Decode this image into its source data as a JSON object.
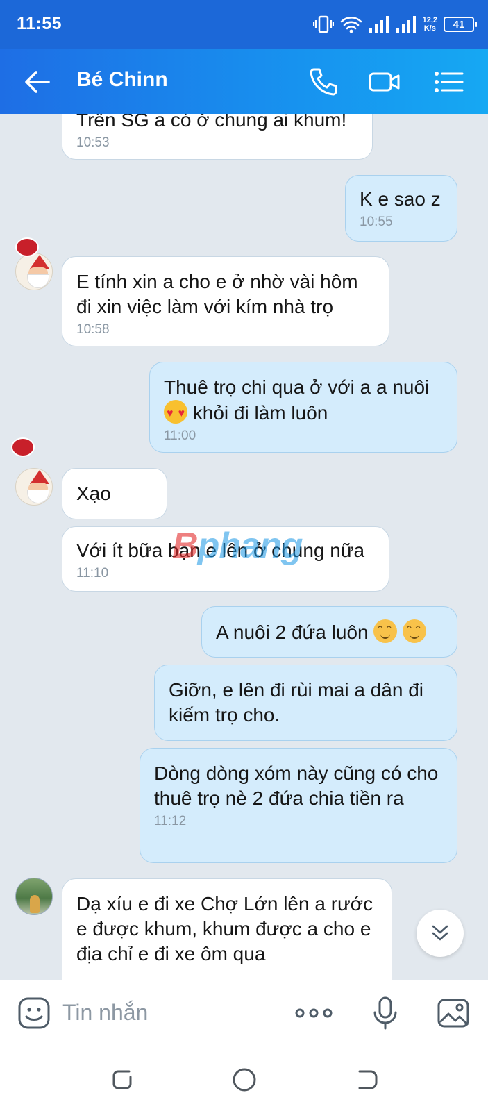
{
  "status_bar": {
    "time": "11:55",
    "net_speed_value": "12,2",
    "net_speed_unit": "K/s",
    "battery": "41"
  },
  "header": {
    "contact_name": "Bé Chinn"
  },
  "watermark": {
    "part1": "B",
    "part2": "phang"
  },
  "messages": [
    {
      "direction": "incoming",
      "text": "Trên SG a có ở chung ai khum!",
      "time": "10:53"
    },
    {
      "direction": "outgoing",
      "text": "K e sao z",
      "time": "10:55"
    },
    {
      "direction": "incoming",
      "text": "E tính xin a cho e ở nhờ vài hôm đi xin việc làm với kím nhà trọ",
      "time": "10:58"
    },
    {
      "direction": "outgoing",
      "text": "Thuê trọ chi qua ở với a a nuôi",
      "text2": "khỏi đi làm luôn",
      "emoji": "heart-eyes",
      "time": "11:00"
    },
    {
      "direction": "incoming",
      "text": "Xạo"
    },
    {
      "direction": "incoming",
      "text": "Với ít bữa bạn e lên ở chung nữa",
      "time": "11:10"
    },
    {
      "direction": "outgoing",
      "text": "A nuôi 2 đứa luôn",
      "emoji": "blush-blush"
    },
    {
      "direction": "outgoing",
      "text": "Giỡn, e lên đi rùi mai a dân đi kiếm trọ cho."
    },
    {
      "direction": "outgoing",
      "text": "Dòng dòng xóm này cũng có cho thuê trọ nè 2 đứa chia tiền ra",
      "time": "11:12"
    },
    {
      "direction": "incoming",
      "text": "Dạ xíu e đi xe Chợ Lớn lên a rước e được khum, khum được a cho e địa chỉ e đi xe ôm qua"
    }
  ],
  "input": {
    "placeholder": "Tin nhắn"
  },
  "colors": {
    "header_start": "#1e6ee5",
    "header_end": "#16a8f3",
    "outgoing_bubble": "#d4ecfc",
    "incoming_bubble": "#ffffff",
    "chat_bg": "#e2e8ee"
  }
}
